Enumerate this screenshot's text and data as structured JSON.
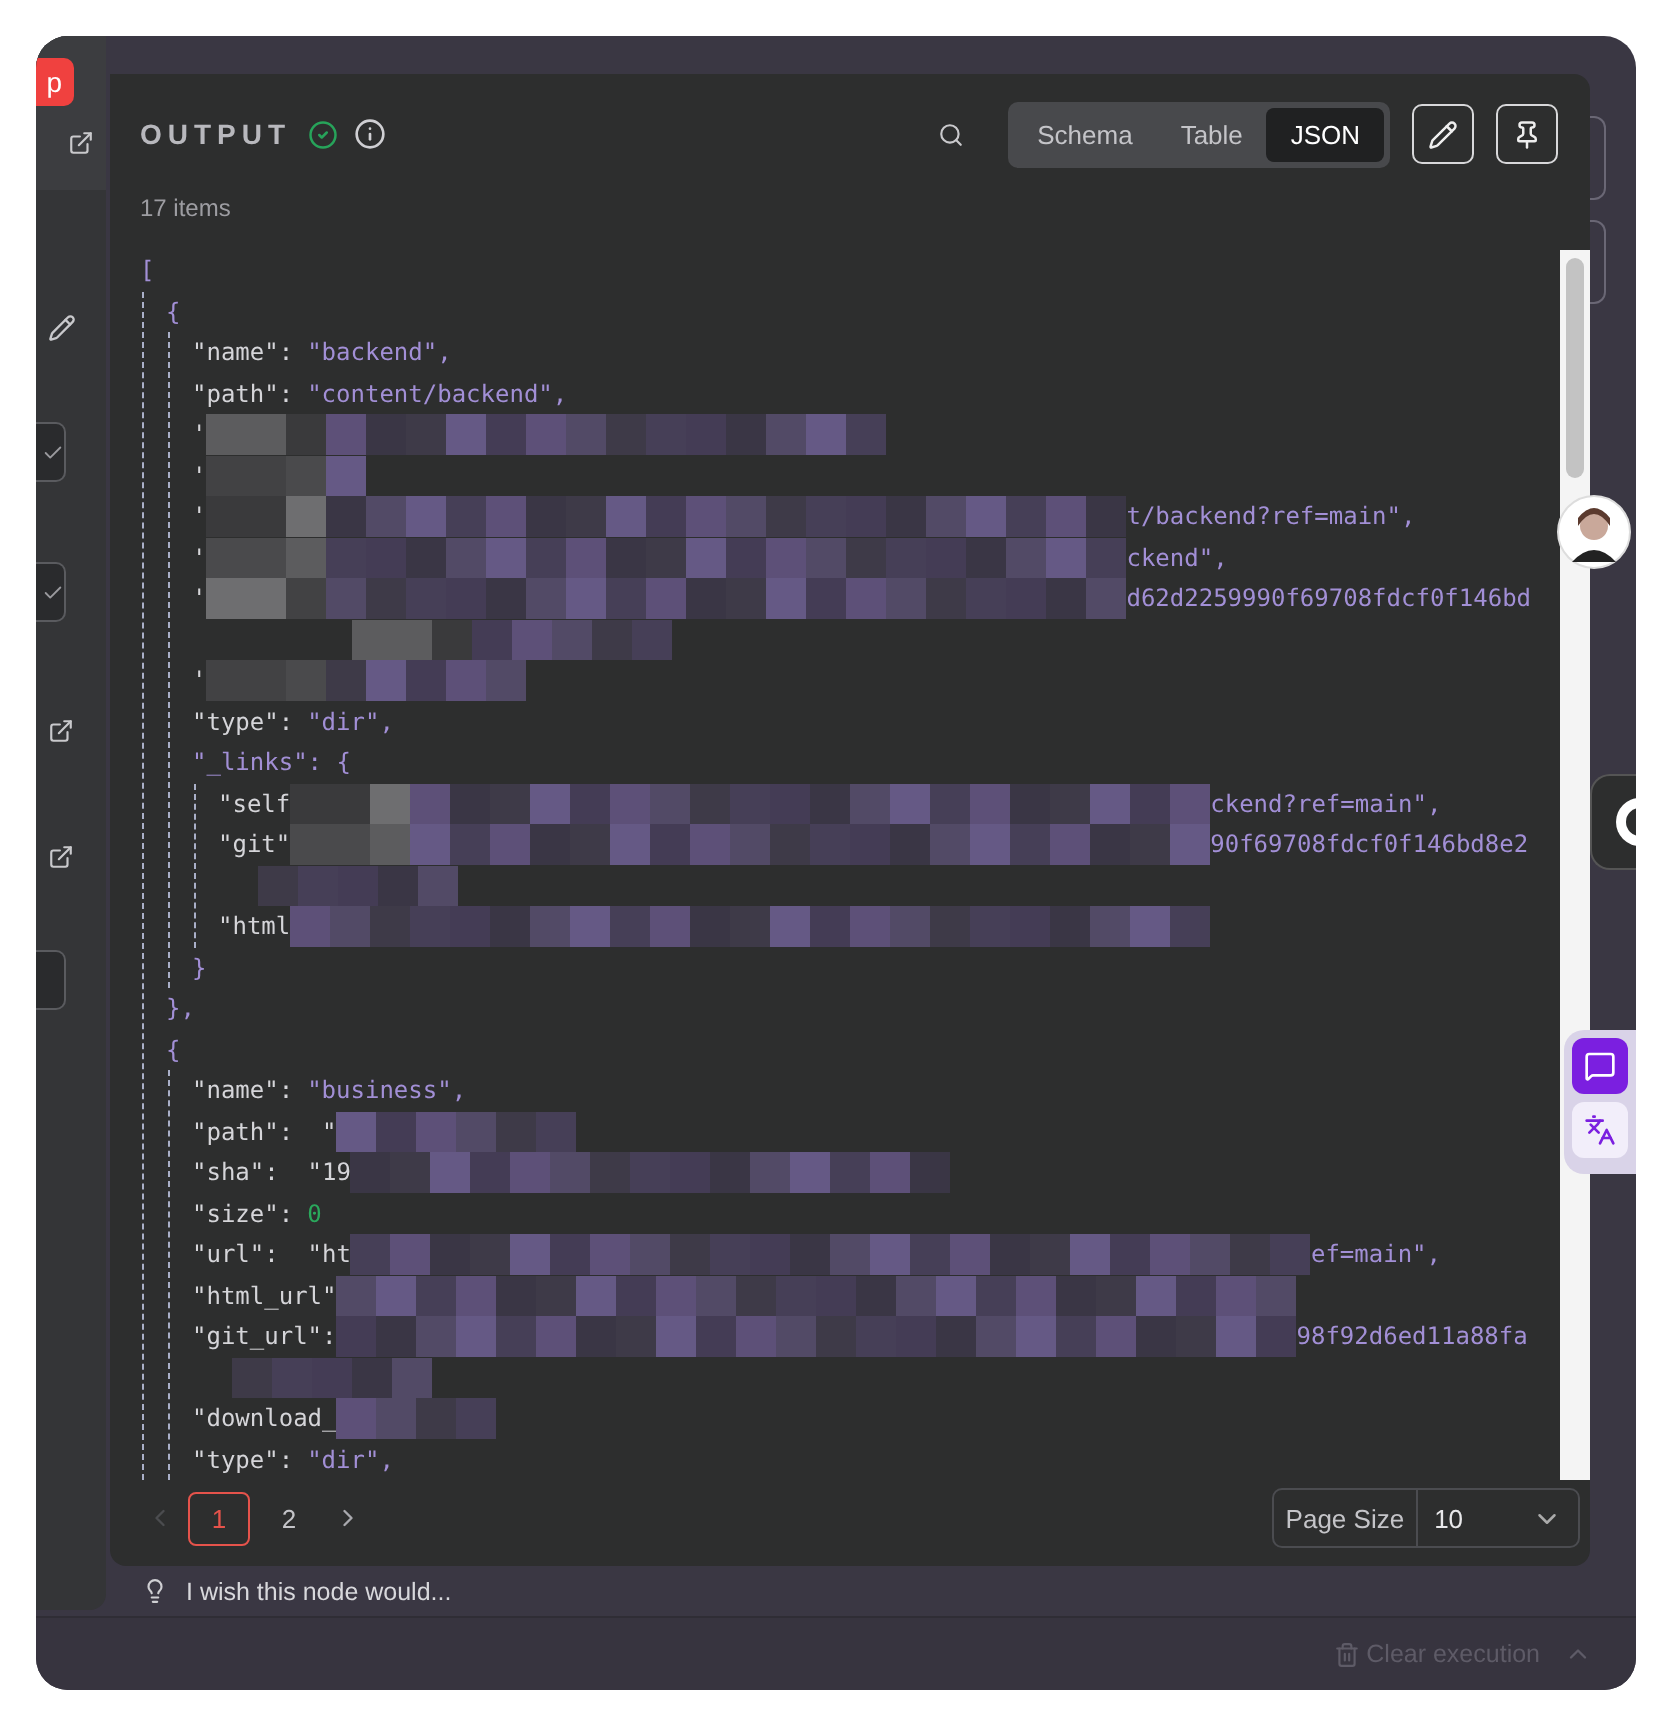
{
  "left_strip": {
    "run_button": "p",
    "items": [
      {
        "kind": "link"
      },
      {
        "kind": "edit"
      },
      {
        "kind": "checkbox",
        "checked": true
      },
      {
        "kind": "checkbox",
        "checked": true
      },
      {
        "kind": "link"
      },
      {
        "kind": "link"
      },
      {
        "kind": "checkbox",
        "checked": false
      }
    ]
  },
  "output": {
    "title": "OUTPUT",
    "succeeded": true,
    "view_tabs": [
      {
        "label": "Schema",
        "selected": false
      },
      {
        "label": "Table",
        "selected": false
      },
      {
        "label": "JSON",
        "selected": true
      }
    ],
    "item_count": "17 items",
    "code": {
      "open": "[",
      "children": [
        {
          "open": "{",
          "close": "},",
          "children": [
            {
              "kind": "string",
              "key": "\"name\":",
              "value": "\"backend\","
            },
            {
              "kind": "string",
              "key": "\"path\":",
              "value": "\"content/backend\","
            },
            {
              "kind": "redacted",
              "lead": "'"
            },
            {
              "kind": "redacted",
              "lead": "'"
            },
            {
              "kind": "redacted",
              "lead": "'",
              "tail": "t/backend?ref=main\","
            },
            {
              "kind": "redacted",
              "lead": "'",
              "tail": "ckend\","
            },
            {
              "kind": "redacted",
              "lead": "'",
              "tail": "d62d2259990f69708fdcf0f146bd"
            },
            {
              "kind": "redacted"
            },
            {
              "kind": "redacted",
              "lead": "'"
            },
            {
              "kind": "string",
              "key": "\"type\":",
              "value": "\"dir\","
            },
            {
              "open": "\"_links\": {",
              "close": "}",
              "children": [
                {
                  "kind": "redacted",
                  "lead": "\"self",
                  "tail": "ckend?ref=main\","
                },
                {
                  "kind": "redacted",
                  "lead": "\"git\"",
                  "tail": "90f69708fdcf0f146bd8e2"
                },
                {
                  "kind": "redacted"
                },
                {
                  "kind": "redacted",
                  "lead": "\"html"
                }
              ]
            }
          ]
        },
        {
          "open": "{",
          "children": [
            {
              "kind": "string",
              "key": "\"name\":",
              "value": "\"business\","
            },
            {
              "kind": "redacted",
              "lead": "\"path\":  \""
            },
            {
              "kind": "redacted",
              "lead": "\"sha\":  \"19"
            },
            {
              "kind": "number",
              "key": "\"size\":",
              "value": "0"
            },
            {
              "kind": "redacted",
              "lead": "\"url\":  \"ht",
              "tail": "ef=main\","
            },
            {
              "kind": "redacted",
              "lead": "\"html_url\""
            },
            {
              "kind": "redacted",
              "lead": "\"git_url\":",
              "tail": "98f92d6ed11a88fa"
            },
            {
              "kind": "redacted"
            },
            {
              "kind": "redacted",
              "lead": "\"download_"
            },
            {
              "kind": "string",
              "key": "\"type\":",
              "value": "\"dir\","
            }
          ]
        }
      ]
    },
    "pages": [
      {
        "label": "1",
        "selected": true
      },
      {
        "label": "2",
        "selected": false
      }
    ],
    "prev_disabled": true,
    "page_size_label": "Page Size",
    "page_size": "10"
  },
  "feedback": "I wish this node would...",
  "footer": {
    "clear_execution": "Clear execution",
    "clear_disabled": true
  }
}
